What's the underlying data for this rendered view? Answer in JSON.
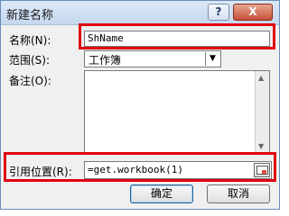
{
  "window": {
    "title": "新建名称",
    "help_label": "?",
    "close_label": "X"
  },
  "form": {
    "name_label": "名称(N):",
    "name_value": "ShName",
    "scope_label": "范围(S):",
    "scope_value": "工作簿",
    "comment_label": "备注(O):",
    "comment_value": "",
    "ref_label": "引用位置(R):",
    "ref_value": "=get.workbook(1)"
  },
  "buttons": {
    "ok_label": "确定",
    "cancel_label": "取消"
  },
  "icons": {
    "dropdown": "chevron-down-icon",
    "scroll_up": "arrow-up-icon",
    "scroll_down": "arrow-down-icon",
    "range": "range-select-icon"
  },
  "colors": {
    "highlight": "#e0000f",
    "title_bg": "#c6d7ee"
  }
}
